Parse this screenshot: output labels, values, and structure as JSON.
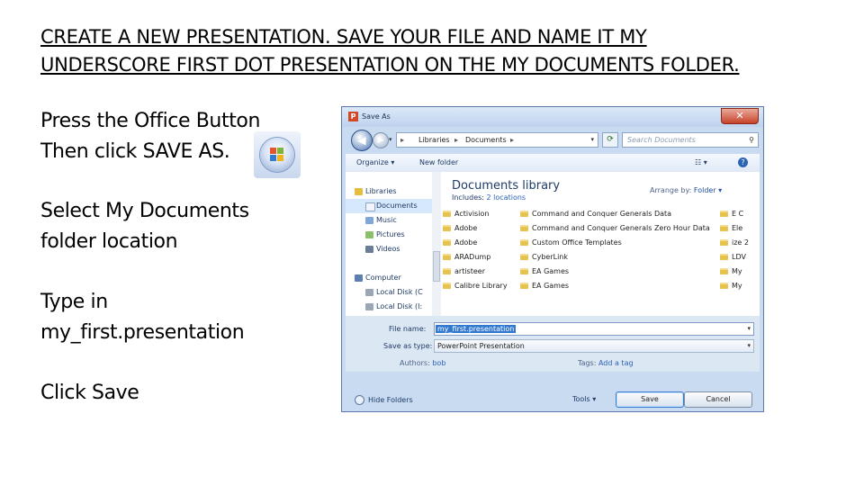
{
  "slide": {
    "title_line1": "CREATE A NEW PRESENTATION. SAVE YOUR FILE AND NAME IT MY",
    "title_line2": "UNDERSCORE FIRST DOT PRESENTATION ON THE MY DOCUMENTS FOLDER.",
    "instructions": {
      "step1_line1": "Press the Office Button",
      "step1_line2": "Then click SAVE AS.",
      "step2_line1": "Select My Documents",
      "step2_line2": "folder location",
      "step3_line1": "Type in",
      "step3_line2": "my_first.presentation",
      "step4": "Click Save"
    }
  },
  "dialog": {
    "title": "Save As",
    "app_icon": "P",
    "close_label": "✕",
    "address": {
      "root": "▸",
      "seg1": "Libraries",
      "sep": "▸",
      "seg2": "Documents",
      "sep2": "▸"
    },
    "search_placeholder": "Search Documents",
    "toolbar": {
      "organize": "Organize ▾",
      "new_folder": "New folder",
      "views": "☷ ▾",
      "help": "?"
    },
    "nav_items": [
      {
        "label": "Libraries",
        "icon": "libraries-icon"
      },
      {
        "label": "Documents",
        "icon": "documents-icon"
      },
      {
        "label": "Music",
        "icon": "music-icon"
      },
      {
        "label": "Pictures",
        "icon": "pictures-icon"
      },
      {
        "label": "Videos",
        "icon": "videos-icon"
      },
      {
        "label": "Computer",
        "icon": "computer-icon"
      },
      {
        "label": "Local Disk (C",
        "icon": "disk-icon"
      },
      {
        "label": "Local Disk (I:",
        "icon": "disk-icon"
      }
    ],
    "library": {
      "title": "Documents library",
      "includes_label": "Includes:",
      "includes_value": "2 locations",
      "arrange_label": "Arrange by:",
      "arrange_value": "Folder ▾"
    },
    "files_col1": [
      "Activision",
      "Adobe",
      "Adobe",
      "ARADump",
      "artisteer",
      "Calibre Library"
    ],
    "files_col2": [
      "Command and Conquer Generals Data",
      "Command and Conquer Generals Zero Hour Data",
      "Custom Office Templates",
      "CyberLink",
      "EA Games",
      "EA Games"
    ],
    "files_col3": [
      "E C",
      "Ele",
      "ize 2",
      "LDV",
      "My",
      "My"
    ],
    "form": {
      "file_name_label": "File name:",
      "file_name_value": "my_first.presentation",
      "save_type_label": "Save as type:",
      "save_type_value": "PowerPoint Presentation",
      "authors_label": "Authors:",
      "authors_value": "bob",
      "tags_label": "Tags:",
      "tags_value": "Add a tag",
      "dropdown_glyph": "▾"
    },
    "footer": {
      "hide_folders": "Hide Folders",
      "tools": "Tools ▾",
      "save": "Save",
      "cancel": "Cancel"
    }
  },
  "colors": {
    "accent": "#3179d0",
    "folder": "#e7c24e",
    "close": "#c7432b"
  }
}
